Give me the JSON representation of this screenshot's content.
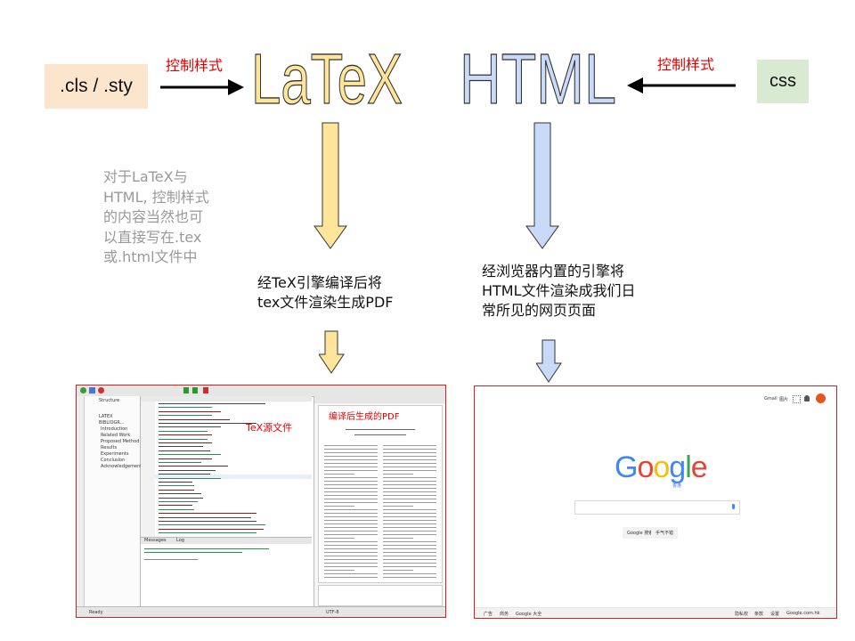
{
  "left_source": {
    "label": ".cls / .sty"
  },
  "right_source": {
    "label": "css"
  },
  "control_label_left": "控制样式",
  "control_label_right": "控制样式",
  "latex_title": "LaTeX",
  "html_title": "HTML",
  "side_note": [
    "对于LaTeX与",
    "HTML, 控制样式",
    "的内容当然也可",
    "以直接写在.tex",
    "或.html文件中"
  ],
  "latex_step": [
    "经TeX引擎编译后将",
    "tex文件渲染生成PDF"
  ],
  "html_step": [
    "经浏览器内置的引擎将",
    "HTML文件渲染成我们日",
    "常所见的网页页面"
  ],
  "colors": {
    "latex": "#ffe599",
    "html": "#c9daf8",
    "cls_box": "#fce5cd",
    "css_box": "#d9ead3",
    "red": "#e00000",
    "frame": "#d32020"
  },
  "editor_screenshot": {
    "tex_source_label": "TeX源文件",
    "pdf_label": "编译后生成的PDF",
    "structure_title": "Structure",
    "structure_items": [
      "LATEX",
      "BIBLIOGR...",
      "Introduction",
      "Related Work",
      "Proposed Method",
      "Results",
      "Experiments",
      "Conclusion",
      "Acknowledgements"
    ],
    "messages_tab": "Messages",
    "log_tab": "Log",
    "status": "Ready",
    "encoding": "UTF-8"
  },
  "google_screenshot": {
    "logo_letters": [
      "G",
      "o",
      "o",
      "g",
      "l",
      "e"
    ],
    "logo_colors": [
      "#4285f4",
      "#ea4335",
      "#fbbc05",
      "#4285f4",
      "#34a853",
      "#ea4335"
    ],
    "logo_sub": "香港",
    "search_button": "Google 搜索",
    "lucky_button": "手气不错",
    "top_links": [
      "Gmail",
      "图片"
    ],
    "footer_left": [
      "广告",
      "商务",
      "Google 大全"
    ],
    "footer_right": [
      "隐私权",
      "条款",
      "设置",
      "Google.com.hk"
    ]
  }
}
